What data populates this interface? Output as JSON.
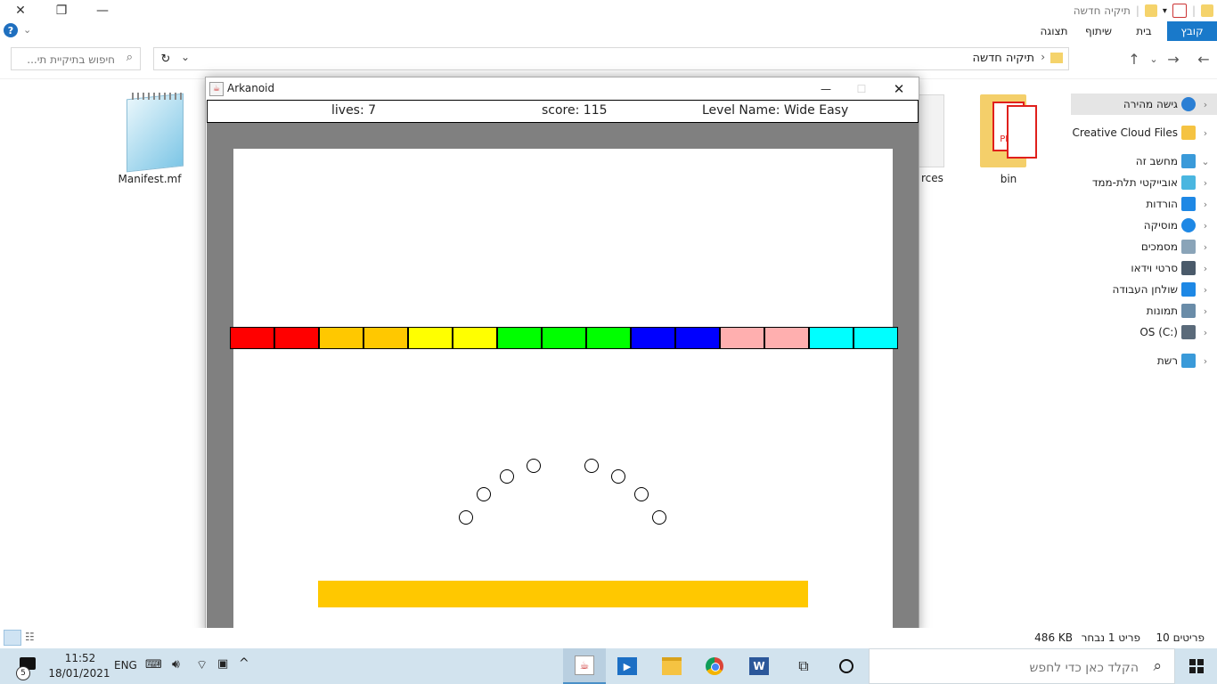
{
  "explorer": {
    "window_title": "תיקיה חדשה",
    "ribbon_tabs": [
      "קובץ",
      "בית",
      "שיתוף",
      "תצוגה"
    ],
    "address_path": "תיקיה חדשה",
    "search_placeholder": "חיפוש בתיקיית תי...",
    "nav_items": [
      {
        "label": "גישה מהירה",
        "icon": "star-icon",
        "color": "#2b7fd4"
      },
      {
        "label": "Creative Cloud Files",
        "icon": "creative-cloud-folder-icon",
        "color": "#f5c342"
      },
      {
        "label": "מחשב זה",
        "icon": "computer-icon",
        "color": "#3a9ad9"
      },
      {
        "label": "אובייקטי תלת-ממד",
        "icon": "cube-3d-icon",
        "color": "#4ab6e0"
      },
      {
        "label": "הורדות",
        "icon": "download-arrow-icon",
        "color": "#1e88e5"
      },
      {
        "label": "מוסיקה",
        "icon": "music-note-icon",
        "color": "#1e88e5"
      },
      {
        "label": "מסמכים",
        "icon": "document-icon",
        "color": "#8aa4b8"
      },
      {
        "label": "סרטי וידאו",
        "icon": "film-icon",
        "color": "#4a5a6a"
      },
      {
        "label": "שולחן העבודה",
        "icon": "desktop-icon",
        "color": "#1e88e5"
      },
      {
        "label": "תמונות",
        "icon": "pictures-icon",
        "color": "#6a8ca8"
      },
      {
        "label": "OS (C:)",
        "icon": "drive-icon",
        "color": "#5a6a7a"
      },
      {
        "label": "רשת",
        "icon": "network-icon",
        "color": "#3a9ad9"
      }
    ],
    "files": [
      {
        "name": "Manifest.mf",
        "icon": "notepad-file-icon"
      },
      {
        "name": "rces",
        "icon": "document-stack-icon"
      },
      {
        "name": "bin",
        "icon": "pdf-folder-icon"
      }
    ],
    "status_left": "10 פריטים",
    "status_selected": "פריט 1 נבחר",
    "status_size": "486 KB"
  },
  "arkanoid": {
    "window_title": "Arkanoid",
    "hud": {
      "lives": "lives: 7",
      "score": "score: 115",
      "level": "Level Name:  Wide Easy"
    },
    "bricks": [
      {
        "color": "#ff0000"
      },
      {
        "color": "#ff0000"
      },
      {
        "color": "#ffc800"
      },
      {
        "color": "#ffc800"
      },
      {
        "color": "#ffff00"
      },
      {
        "color": "#ffff00"
      },
      {
        "color": "#00ff00"
      },
      {
        "color": "#00ff00"
      },
      {
        "color": "#00ff00"
      },
      {
        "color": "#0000ff"
      },
      {
        "color": "#0000ff"
      },
      {
        "color": "#ffafaf"
      },
      {
        "color": "#ffafaf"
      },
      {
        "color": "#00ffff"
      },
      {
        "color": "#00ffff"
      }
    ],
    "ball_count": 10,
    "paddle_color": "#ffc800",
    "border_color": "#808080"
  },
  "taskbar": {
    "search_placeholder": "הקלד כאן כדי לחפש",
    "time": "11:52",
    "date": "18/01/2021",
    "language": "ENG",
    "notification_count": "5",
    "apps": [
      "java-icon",
      "media-player-icon",
      "file-explorer-icon",
      "chrome-icon",
      "word-icon",
      "task-view-icon",
      "cortana-icon"
    ]
  }
}
